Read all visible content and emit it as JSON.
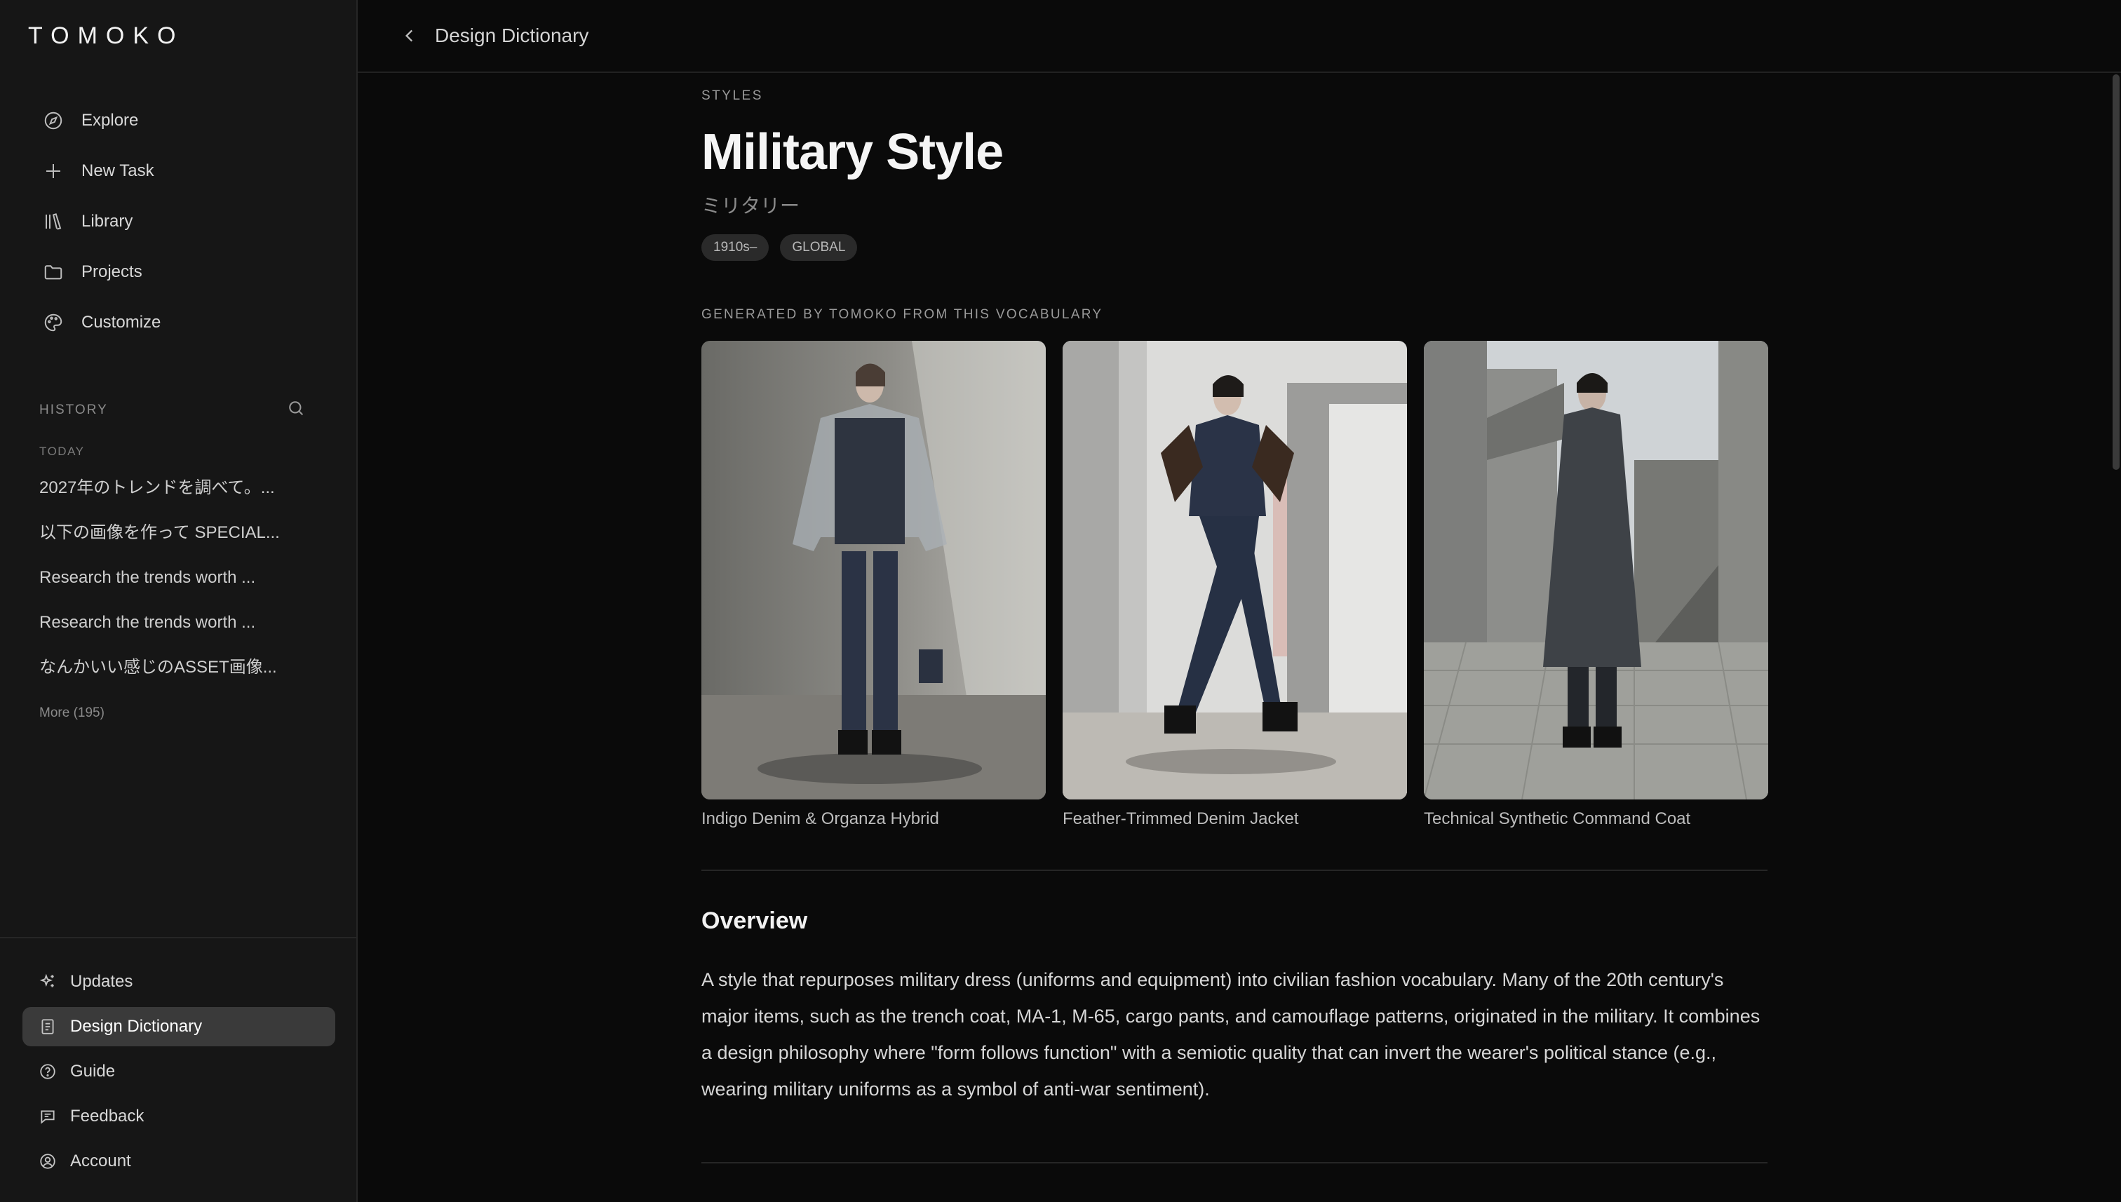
{
  "brand": "TOMOKO",
  "nav": [
    {
      "label": "Explore",
      "icon": "compass-icon"
    },
    {
      "label": "New Task",
      "icon": "plus-icon"
    },
    {
      "label": "Library",
      "icon": "library-icon"
    },
    {
      "label": "Projects",
      "icon": "folder-icon"
    },
    {
      "label": "Customize",
      "icon": "palette-icon"
    }
  ],
  "history": {
    "label": "HISTORY",
    "today": "TODAY",
    "items": [
      "2027年のトレンドを調べて。...",
      "以下の画像を作って SPECIAL...",
      "Research the trends worth ...",
      "Research the trends worth ...",
      "なんかいい感じのASSET画像..."
    ],
    "more": "More (195)"
  },
  "bottom_nav": [
    {
      "label": "Updates",
      "icon": "sparkles-icon",
      "active": false
    },
    {
      "label": "Design Dictionary",
      "icon": "book-icon",
      "active": true
    },
    {
      "label": "Guide",
      "icon": "help-circle-icon",
      "active": false
    },
    {
      "label": "Feedback",
      "icon": "message-icon",
      "active": false
    },
    {
      "label": "Account",
      "icon": "user-circle-icon",
      "active": false
    }
  ],
  "topbar": {
    "title": "Design Dictionary"
  },
  "entry": {
    "eyebrow": "STYLES",
    "title": "Military Style",
    "subtitle_jp": "ミリタリー",
    "tags": [
      "1910s–",
      "GLOBAL"
    ],
    "generated_label": "GENERATED BY TOMOKO FROM THIS VOCABULARY",
    "images": [
      {
        "caption": "Indigo Denim & Organza Hybrid"
      },
      {
        "caption": "Feather-Trimmed Denim Jacket"
      },
      {
        "caption": "Technical Synthetic Command Coat"
      }
    ],
    "overview_heading": "Overview",
    "overview_text": "A style that repurposes military dress (uniforms and equipment) into civilian fashion vocabulary. Many of the 20th century's major items, such as the trench coat, MA-1, M-65, cargo pants, and camouflage patterns, originated in the military. It combines a design philosophy where \"form follows function\" with a semiotic quality that can invert the wearer's political stance (e.g., wearing military uniforms as a symbol of anti-war sentiment)."
  }
}
